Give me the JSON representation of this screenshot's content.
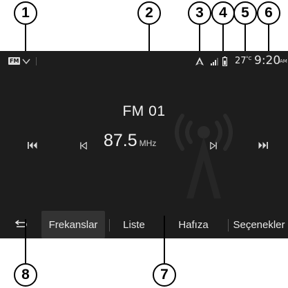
{
  "callouts": {
    "c1": "1",
    "c2": "2",
    "c3": "3",
    "c4": "4",
    "c5": "5",
    "c6": "6",
    "c7": "7",
    "c8": "8"
  },
  "statusbar": {
    "source_badge": "FM",
    "temperature": "27",
    "temp_unit": "°C",
    "time": "9:20",
    "ampm": "AM"
  },
  "player": {
    "station": "FM 01",
    "frequency": "87.5",
    "unit": "MHz"
  },
  "tabs": [
    {
      "label": "Frekanslar",
      "active": true
    },
    {
      "label": "Liste",
      "active": false
    },
    {
      "label": "Hafıza",
      "active": false
    },
    {
      "label": "Seçenekler",
      "active": false
    }
  ],
  "icons": {
    "back": "back-arrow-icon",
    "prev_station": "skip-back-icon",
    "seek_back": "seek-back-icon",
    "seek_forward": "seek-forward-icon",
    "next_station": "skip-forward-icon",
    "navigation": "navigation-arrow-icon",
    "signal": "signal-strength-icon",
    "battery": "phone-battery-icon",
    "watermark": "radio-tower-icon"
  },
  "colors": {
    "screen_bg": "#1d1d1d",
    "text": "#f2f2f2",
    "active_tab": "#333333"
  }
}
